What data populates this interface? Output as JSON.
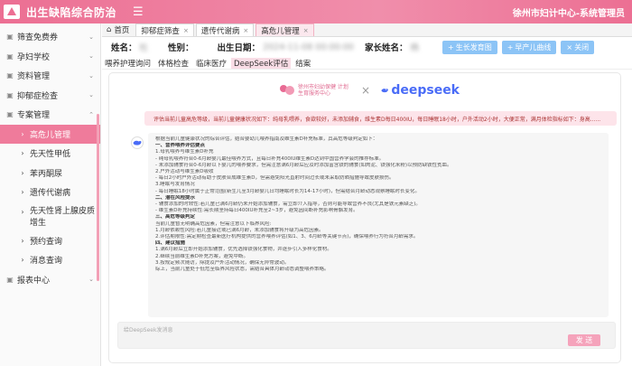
{
  "app": {
    "title": "出生缺陷综合防治",
    "right_text": "徐州市妇计中心-系统管理员"
  },
  "sidebar": {
    "items": [
      {
        "label": "筛查免费券",
        "icon": "ticket-icon"
      },
      {
        "label": "孕妇学校",
        "icon": "school-icon"
      },
      {
        "label": "资料管理",
        "icon": "file-icon"
      },
      {
        "label": "抑郁症检查",
        "icon": "check-icon"
      },
      {
        "label": "专案管理",
        "icon": "folder-icon"
      }
    ],
    "sub_items": [
      {
        "label": "高危儿管理",
        "active": true
      },
      {
        "label": "先天性甲低"
      },
      {
        "label": "苯丙酮尿"
      },
      {
        "label": "遗传代谢病"
      },
      {
        "label": "先天性肾上腺皮质增生",
        "multi": true
      },
      {
        "label": "预约查询"
      },
      {
        "label": "消息查询"
      }
    ],
    "last": {
      "label": "报表中心"
    }
  },
  "tabs": [
    {
      "label": "首页",
      "closable": false
    },
    {
      "label": "抑郁症筛查",
      "closable": true
    },
    {
      "label": "遗传代谢病",
      "closable": true
    },
    {
      "label": "高危儿管理",
      "closable": true,
      "active": true
    }
  ],
  "info": {
    "name_label": "姓名：",
    "name_value": "杜",
    "sex_label": "性别：",
    "dob_label": "出生日期：",
    "dob_value": "2024-11-08 00:00:00",
    "parent_label": "家长姓名：",
    "parent_value": "杨",
    "buttons": [
      "生长发育图",
      "早产儿曲线",
      "关闭"
    ]
  },
  "subtabs": [
    "喂养护理询问",
    "体格检查",
    "临床医疗",
    "DeepSeek评估",
    "结案"
  ],
  "chat": {
    "org_name": "徐州市妇幼保健 计划生育服务中心",
    "times": "×",
    "brand": "deepseek",
    "user_message": "评估当前儿童高危等级，当前儿童健康状况如下：纯母乳喂养，食欲较好，未添加辅食，维生素D每日400IU，每日睡眠18小时，户外活动2小时，大便正常，满月体检指标如下：身高......",
    "reply": [
      {
        "text": "根据当前儿童健康状况的综合评估，结合婴幼儿喂养指南及维生素D补充标准，其高危等级判定如下：",
        "h": false
      },
      {
        "text": "一、营养喂养评估要点",
        "h": true
      },
      {
        "text": "1.母乳喂养与维生素D补充",
        "h": false
      },
      {
        "text": "- 纯母乳喂养符合0-6月龄婴儿最佳喂养方式，且每日补充400IU维生素D达到中国营养学会的推荐标准。",
        "h": false
      },
      {
        "text": "- 未添加辅食符合0-6月龄以下婴儿的喂养要求，但需注意满6月龄后应及时添加富含铁的辅食(如肉泥、铁强化米粉)以预防缺铁性贫血。",
        "h": false
      },
      {
        "text": "2.户外活动与维生素D吸收",
        "h": false
      },
      {
        "text": "- 每日2小时户外活动有助于皮肤合成维生素D，但需避免阳光直射时间过长或未采取防晒措施导致皮肤损伤。",
        "h": false
      },
      {
        "text": "3.睡眠与发育情况",
        "h": false
      },
      {
        "text": "- 每日睡眠18小时属于正常范围(新生儿至3月龄婴儿日均睡眠时长为14-17小时)，但需结合月龄动态观察睡眠时长变化。",
        "h": false
      },
      {
        "text": "二、潜在风险提示",
        "h": true
      },
      {
        "text": "- 辅食添加的时效性:若儿童已满6月龄仍未开始添加辅食，需立即介入指导，否则可能导致营养不良(尤其是铁元素缺乏)。",
        "h": false
      },
      {
        "text": "- 维生素D补充持续性:需长期坚持每日400IU补充至2~3岁，避免因间断补充影响骨骼发育。",
        "h": false
      },
      {
        "text": "三、高危等级判定",
        "h": true
      },
      {
        "text": "当前儿童暂无明确高危因素，但需注意以下临界风险:",
        "h": false
      },
      {
        "text": "1.月龄依赖性风险:若儿童接近或已满6月龄，未添加辅食将升级为高危因素。",
        "h": false
      },
      {
        "text": "2.评估期限性:需定期检查最新医疗机构提供的营养喂养评估(如1、3、6月龄等关键节点)，确保喂养行为符合月龄需求。",
        "h": false
      },
      {
        "text": "四、建议措施",
        "h": true
      },
      {
        "text": "1.满6月龄后立即开始添加辅食，优先选择铁强化食物，并逐步引入多样化食材。",
        "h": false
      },
      {
        "text": "2.继续当前维生素D补充方案，避免中断。",
        "h": false
      },
      {
        "text": "3.按规定频次随访，除提及户外活动情况，确保无异常波动。",
        "h": false
      },
      {
        "text": "综上，当前儿童处于低危至临界风险状态，需结合具体月龄动态调整喂养策略。",
        "h": false
      }
    ],
    "input_placeholder": "给DeepSeek发消息",
    "send_label": "发 送"
  },
  "colors": {
    "primary": "#ec6f93",
    "button_blue": "#8cc4f6",
    "deepseek_blue": "#4a6cf7"
  }
}
